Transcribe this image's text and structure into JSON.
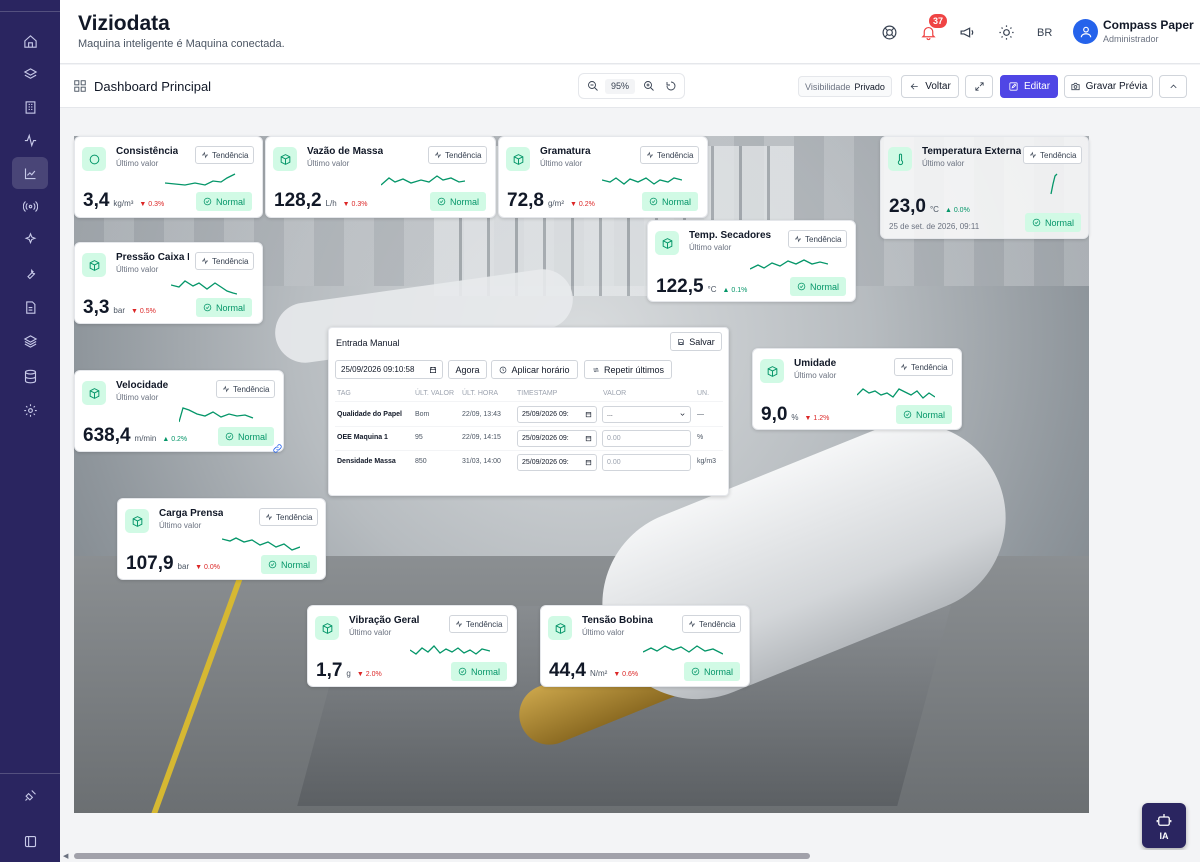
{
  "app": {
    "title": "Viziodata",
    "tagline": "Maquina inteligente é Maquina conectada."
  },
  "header": {
    "notifications_count": "37",
    "language": "BR",
    "user_name": "Compass Paper",
    "user_role": "Administrador"
  },
  "toolbar": {
    "dashboard_title": "Dashboard Principal",
    "zoom": "95%",
    "visibility_label": "Visibilidade",
    "visibility_value": "Privado",
    "back_label": "Voltar",
    "edit_label": "Editar",
    "preview_label": "Gravar Prévia"
  },
  "colors": {
    "accent": "#4f46e5",
    "sidebar": "#2a2560",
    "normal": "#059669",
    "down": "#dc2626"
  },
  "cards": {
    "consistencia": {
      "name": "Consistência",
      "sub": "Último valor",
      "trend": "Tendência",
      "value": "3,4",
      "unit": "kg/m³",
      "delta": "▼ 0.3%",
      "status": "Normal"
    },
    "vazao": {
      "name": "Vazão de Massa",
      "sub": "Último valor",
      "trend": "Tendência",
      "value": "128,2",
      "unit": "L/h",
      "delta": "▼ 0.3%",
      "status": "Normal"
    },
    "gramatura": {
      "name": "Gramatura",
      "sub": "Último valor",
      "trend": "Tendência",
      "value": "72,8",
      "unit": "g/m²",
      "delta": "▼ 0.2%",
      "status": "Normal"
    },
    "temp_ext": {
      "name": "Temperatura Externa",
      "sub": "Último valor",
      "trend": "Tendência",
      "value": "23,0",
      "unit": "°C",
      "delta": "▲ 0.0%",
      "timestamp": "25 de set. de 2026, 09:11",
      "status": "Normal"
    },
    "pressao": {
      "name": "Pressão Caixa E...",
      "sub": "Último valor",
      "trend": "Tendência",
      "value": "3,3",
      "unit": "bar",
      "delta": "▼ 0.5%",
      "status": "Normal"
    },
    "temp_sec": {
      "name": "Temp. Secadores",
      "sub": "Último valor",
      "trend": "Tendência",
      "value": "122,5",
      "unit": "°C",
      "delta": "▲ 0.1%",
      "status": "Normal"
    },
    "velocidade": {
      "name": "Velocidade",
      "sub": "Último valor",
      "trend": "Tendência",
      "value": "638,4",
      "unit": "m/min",
      "delta": "▲ 0.2%",
      "status": "Normal"
    },
    "umidade": {
      "name": "Umidade",
      "sub": "Último valor",
      "trend": "Tendência",
      "value": "9,0",
      "unit": "%",
      "delta": "▼ 1.2%",
      "status": "Normal"
    },
    "carga": {
      "name": "Carga Prensa",
      "sub": "Último valor",
      "trend": "Tendência",
      "value": "107,9",
      "unit": "bar",
      "delta": "▼ 0.0%",
      "status": "Normal"
    },
    "vibracao": {
      "name": "Vibração Geral",
      "sub": "Último valor",
      "trend": "Tendência",
      "value": "1,7",
      "unit": "g",
      "delta": "▼ 2.0%",
      "status": "Normal"
    },
    "tensao": {
      "name": "Tensão Bobina",
      "sub": "Último valor",
      "trend": "Tendência",
      "value": "44,4",
      "unit": "N/m²",
      "delta": "▼ 0.6%",
      "status": "Normal"
    }
  },
  "entry": {
    "title": "Entrada Manual",
    "save": "Salvar",
    "datetime": "25/09/2026 09:10:58",
    "now": "Agora",
    "apply": "Aplicar horário",
    "repeat": "Repetir últimos",
    "headers": [
      "TAG",
      "ÚLT. VALOR",
      "ÚLT. HORA",
      "TIMESTAMP",
      "VALOR",
      "UN."
    ],
    "rows": [
      {
        "tag": "Qualidade do Papel",
        "last_value": "Bom",
        "last_time": "22/09, 13:43",
        "timestamp": "25/09/2026 09:",
        "value": "...",
        "unit": "—"
      },
      {
        "tag": "OEE Maquina 1",
        "last_value": "95",
        "last_time": "22/09, 14:15",
        "timestamp": "25/09/2026 09:",
        "value": "0.00",
        "unit": "%"
      },
      {
        "tag": "Densidade Massa",
        "last_value": "850",
        "last_time": "31/03, 14:00",
        "timestamp": "25/09/2026 09:",
        "value": "0.00",
        "unit": "kg/m3"
      }
    ]
  },
  "ia_label": "IA"
}
